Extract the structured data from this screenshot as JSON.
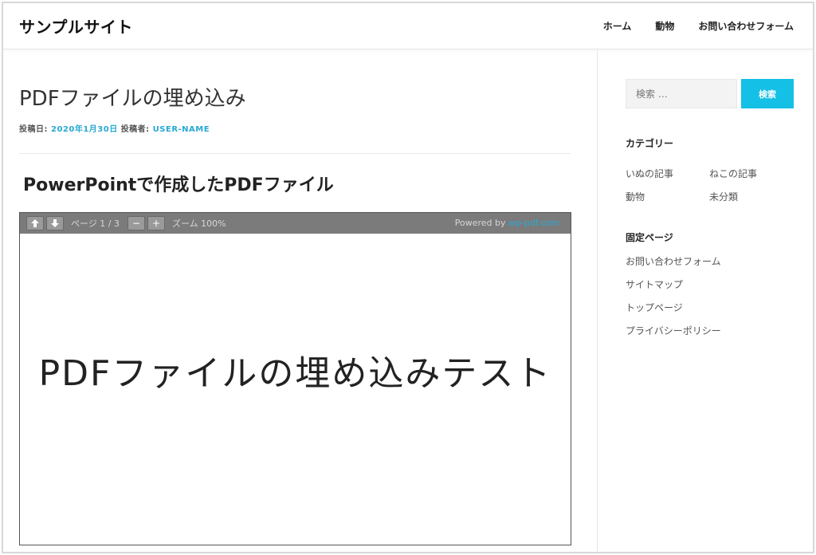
{
  "site": {
    "title": "サンプルサイト"
  },
  "nav": {
    "items": [
      "ホーム",
      "動物",
      "お問い合わせフォーム"
    ]
  },
  "post": {
    "title": "PDFファイルの埋め込み",
    "meta_date_label": "投稿日:",
    "meta_date": "2020年1月30日",
    "meta_author_label": "投稿者:",
    "meta_author": "USER-NAME",
    "section_heading": "PowerPointで作成したPDFファイル"
  },
  "viewer": {
    "prev_icon": "arrow-up-icon",
    "next_icon": "arrow-down-icon",
    "page_info": "ページ 1 / 3",
    "zoom_out": "−",
    "zoom_in": "+",
    "zoom_info": "ズーム 100%",
    "powered_label": "Powered by",
    "powered_link": "wp-pdf.com",
    "page_text": "PDFファイルの埋め込みテスト"
  },
  "sidebar": {
    "search": {
      "placeholder": "検索 …",
      "button": "検索"
    },
    "categories": {
      "title": "カテゴリー",
      "items": [
        "いぬの記事",
        "ねこの記事",
        "動物",
        "未分類"
      ]
    },
    "pages": {
      "title": "固定ページ",
      "items": [
        "お問い合わせフォーム",
        "サイトマップ",
        "トップページ",
        "プライバシーポリシー"
      ]
    }
  },
  "colors": {
    "accent": "#14c0e6",
    "link": "#29a8d4",
    "toolbar": "#7b7b7b"
  }
}
